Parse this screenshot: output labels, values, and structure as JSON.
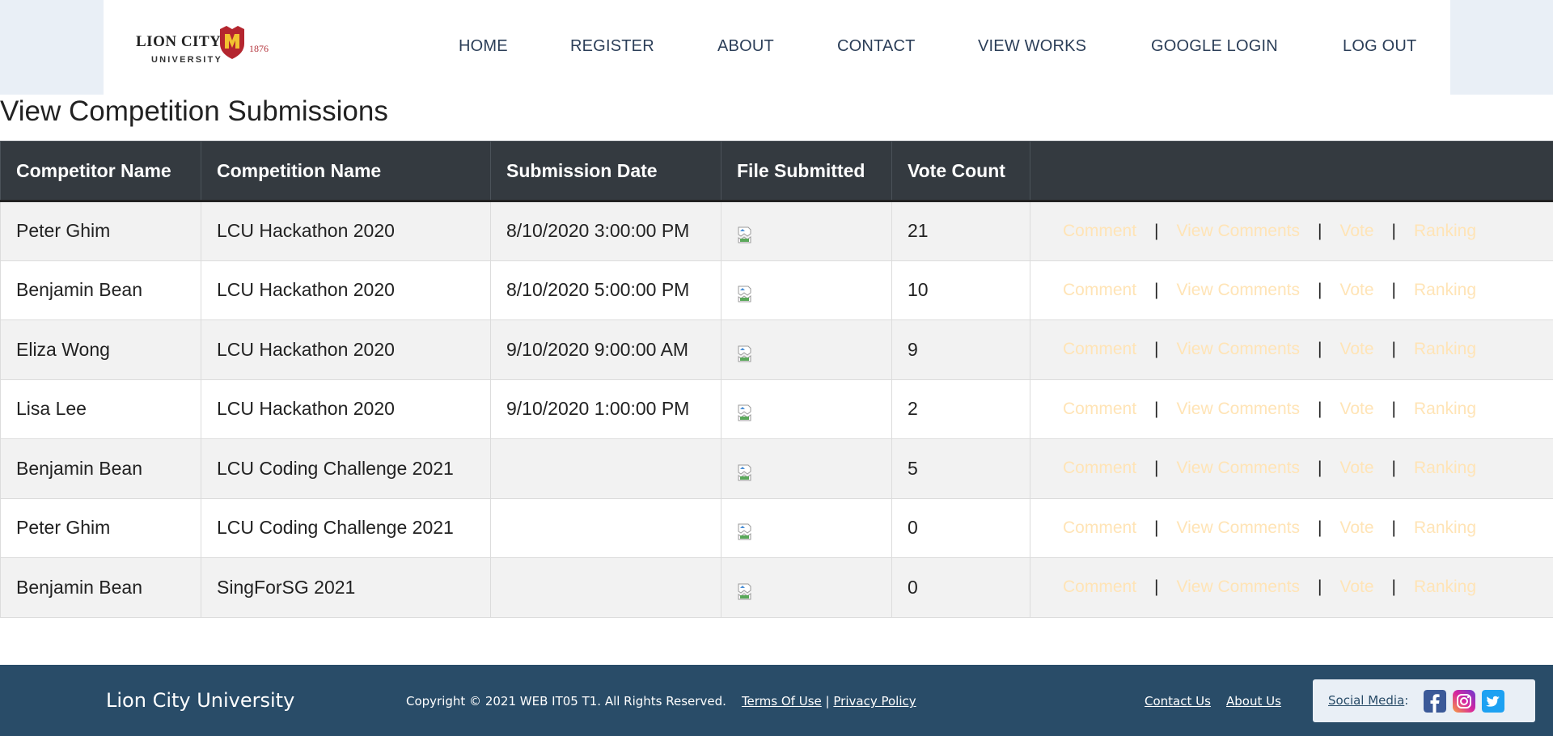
{
  "brand": {
    "logo_line1": "LION CITY",
    "logo_line2": "UNIVERSITY",
    "logo_year": "1876"
  },
  "nav": {
    "items": [
      {
        "label": "HOME"
      },
      {
        "label": "REGISTER"
      },
      {
        "label": "ABOUT"
      },
      {
        "label": "CONTACT"
      },
      {
        "label": "VIEW WORKS"
      },
      {
        "label": "GOOGLE LOGIN"
      },
      {
        "label": "LOG OUT"
      }
    ]
  },
  "page": {
    "title": "View Competition Submissions"
  },
  "table": {
    "headers": [
      "Competitor Name",
      "Competition Name",
      "Submission Date",
      "File Submitted",
      "Vote Count"
    ],
    "actions": {
      "comment": "Comment",
      "view_comments": "View Comments",
      "vote": "Vote",
      "ranking": "Ranking",
      "separator": "|"
    },
    "rows": [
      {
        "competitor": "Peter Ghim",
        "competition": "LCU Hackathon 2020",
        "date": "8/10/2020 3:00:00 PM",
        "votes": "21"
      },
      {
        "competitor": "Benjamin Bean",
        "competition": "LCU Hackathon 2020",
        "date": "8/10/2020 5:00:00 PM",
        "votes": "10"
      },
      {
        "competitor": "Eliza Wong",
        "competition": "LCU Hackathon 2020",
        "date": "9/10/2020 9:00:00 AM",
        "votes": "9"
      },
      {
        "competitor": "Lisa Lee",
        "competition": "LCU Hackathon 2020",
        "date": "9/10/2020 1:00:00 PM",
        "votes": "2"
      },
      {
        "competitor": "Benjamin Bean",
        "competition": "LCU Coding Challenge 2021",
        "date": "",
        "votes": "5"
      },
      {
        "competitor": "Peter Ghim",
        "competition": "LCU Coding Challenge 2021",
        "date": "",
        "votes": "0"
      },
      {
        "competitor": "Benjamin Bean",
        "competition": "SingForSG 2021",
        "date": "",
        "votes": "0"
      }
    ]
  },
  "footer": {
    "brand": "Lion City University",
    "copyright": "Copyright © 2021 WEB IT05 T1. All Rights Reserved.",
    "terms": "Terms Of Use",
    "divider": "|",
    "privacy": "Privacy Policy",
    "contact": "Contact Us",
    "about": "About Us",
    "social_label": "Social Media",
    "social_colon": ":"
  },
  "colors": {
    "header_bg": "#343a40",
    "footer_bg": "#294c68",
    "action_link": "#ffe4b6",
    "nav_text": "#2b3e58",
    "accent_red": "#b4343c"
  }
}
